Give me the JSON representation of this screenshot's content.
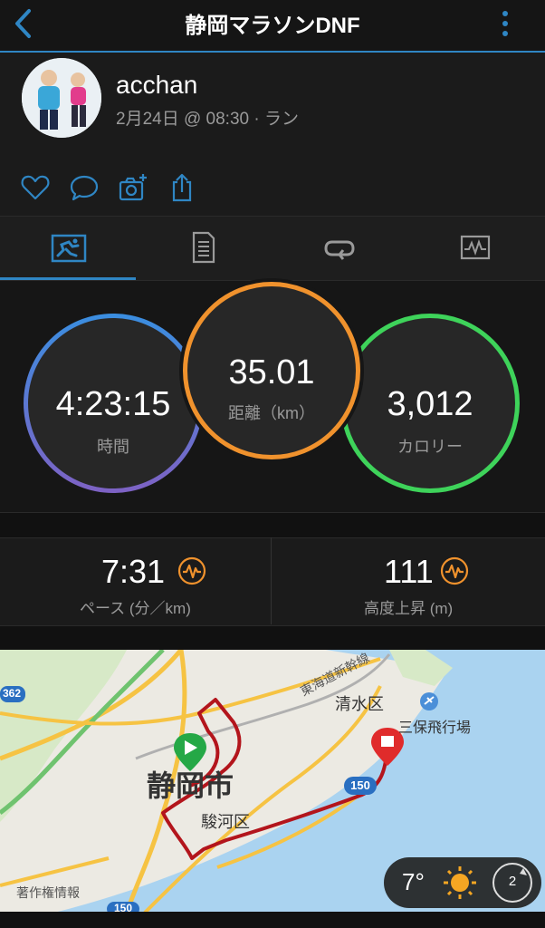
{
  "header": {
    "title": "静岡マラソンDNF"
  },
  "profile": {
    "username": "acchan",
    "meta": "2月24日 @ 08:30 · ラン"
  },
  "tabs": [
    "summary",
    "details",
    "laps",
    "charts"
  ],
  "summary": {
    "time": {
      "value": "4:23:15",
      "label": "時間"
    },
    "distance": {
      "value": "35.01",
      "label": "距離（km）"
    },
    "calories": {
      "value": "3,012",
      "label": "カロリー"
    }
  },
  "stats": {
    "pace": {
      "value": "7:31",
      "label": "ペース (分／km)"
    },
    "elevation": {
      "value": "111",
      "label": "高度上昇 (m)"
    }
  },
  "map": {
    "labels": {
      "shimizu": "清水区",
      "airport": "三保飛行場",
      "tokaido": "東海道新幹線",
      "shizuoka": "静岡市",
      "suruga": "駿河区",
      "copyright": "著作権情報",
      "route150": "150",
      "route150b": "150",
      "route362": "362"
    }
  },
  "weather": {
    "temp": "7°",
    "wind": "2"
  },
  "colors": {
    "accent": "#2f86c4",
    "time_ring": "#3a8ee0",
    "distance_ring": "#f0922d",
    "calorie_ring": "#3ed35a",
    "route": "#b3151c"
  }
}
